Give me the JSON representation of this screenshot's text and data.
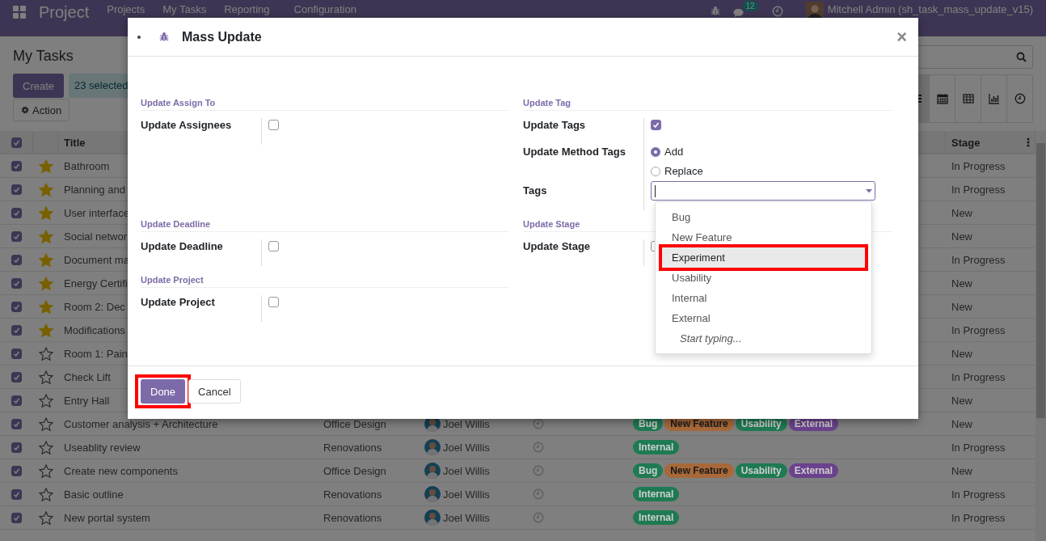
{
  "navbar": {
    "app_name": "Project",
    "menu": [
      "Projects",
      "My Tasks",
      "Reporting",
      "Configuration"
    ],
    "chat_badge": "12",
    "user": "Mitchell Admin (sh_task_mass_update_v15)"
  },
  "control_panel": {
    "title": "My Tasks",
    "create_button": "Create",
    "selection": "23 selected",
    "action_button": "Action",
    "views": [
      {
        "kind": "list",
        "selected": true
      },
      {
        "kind": "calendar",
        "selected": false
      },
      {
        "kind": "pivot",
        "selected": false
      },
      {
        "kind": "graph",
        "selected": false
      },
      {
        "kind": "activity",
        "selected": false
      }
    ]
  },
  "table": {
    "all_checked": true,
    "columns": [
      "Title",
      "Stage"
    ],
    "rows": [
      {
        "checked": true,
        "starred": true,
        "title": "Bathroom",
        "stage": "In Progress"
      },
      {
        "checked": true,
        "starred": true,
        "title": "Planning and",
        "stage": "In Progress"
      },
      {
        "checked": true,
        "starred": true,
        "title": "User interface",
        "stage": "New"
      },
      {
        "checked": true,
        "starred": true,
        "title": "Social networ",
        "stage": "New"
      },
      {
        "checked": true,
        "starred": true,
        "title": "Document ma",
        "stage": "In Progress"
      },
      {
        "checked": true,
        "starred": true,
        "title": "Energy Certifi",
        "stage": "New"
      },
      {
        "checked": true,
        "starred": true,
        "title": "Room 2: Dec",
        "stage": "New"
      },
      {
        "checked": true,
        "starred": true,
        "title": "Modifications",
        "stage": "In Progress"
      },
      {
        "checked": true,
        "starred": false,
        "title": "Room 1: Pain",
        "stage": "New"
      },
      {
        "checked": true,
        "starred": false,
        "title": "Check Lift",
        "stage": "In Progress"
      },
      {
        "checked": true,
        "starred": false,
        "title": "Entry Hall",
        "stage": "New"
      },
      {
        "checked": true,
        "starred": false,
        "title": "Customer analysis + Architecture",
        "project": "Office Design",
        "assignee": "Joel Willis",
        "tags": [
          {
            "label": "Bug",
            "color": "#1e7a52"
          },
          {
            "label": "New Feature",
            "color": "#a8693a"
          },
          {
            "label": "Usability",
            "color": "#1e7a52"
          },
          {
            "label": "External",
            "color": "#6a428c"
          }
        ],
        "stage": "New"
      },
      {
        "checked": true,
        "starred": false,
        "title": "Useablity review",
        "project": "Renovations",
        "assignee": "Joel Willis",
        "tags": [
          {
            "label": "Internal",
            "color": "#1e7a52"
          }
        ],
        "stage": "In Progress"
      },
      {
        "checked": true,
        "starred": false,
        "title": "Create new components",
        "project": "Office Design",
        "assignee": "Joel Willis",
        "tags": [
          {
            "label": "Bug",
            "color": "#1e7a52"
          },
          {
            "label": "New Feature",
            "color": "#a8693a"
          },
          {
            "label": "Usability",
            "color": "#1e7a52"
          },
          {
            "label": "External",
            "color": "#6a428c"
          }
        ],
        "stage": "New"
      },
      {
        "checked": true,
        "starred": false,
        "title": "Basic outline",
        "project": "Renovations",
        "assignee": "Joel Willis",
        "tags": [
          {
            "label": "Internal",
            "color": "#1e7a52"
          }
        ],
        "stage": "In Progress"
      },
      {
        "checked": true,
        "starred": false,
        "title": "New portal system",
        "project": "Renovations",
        "assignee": "Joel Willis",
        "tags": [
          {
            "label": "Internal",
            "color": "#1e7a52"
          }
        ],
        "stage": "In Progress"
      }
    ]
  },
  "dialog": {
    "title": "Mass Update",
    "close": "×",
    "columns": [
      [
        {
          "heading": "Update Assign To",
          "fields": [
            {
              "kind": "checkbox",
              "label": "Update Assignees",
              "checked": false
            }
          ]
        },
        {
          "heading": "Update Deadline",
          "fields": [
            {
              "kind": "checkbox",
              "label": "Update Deadline",
              "checked": false
            }
          ]
        },
        {
          "heading": "Update Project",
          "fields": [
            {
              "kind": "checkbox",
              "label": "Update Project",
              "checked": false
            }
          ]
        }
      ],
      [
        {
          "heading": "Update Tag",
          "fields": [
            {
              "kind": "checkbox",
              "label": "Update Tags",
              "checked": true
            },
            {
              "kind": "radio",
              "label": "Update Method Tags",
              "options": [
                {
                  "label": "Add",
                  "selected": true
                },
                {
                  "label": "Replace",
                  "selected": false
                }
              ]
            },
            {
              "kind": "tags",
              "label": "Tags",
              "dropdown": {
                "options": [
                  {
                    "label": "Bug",
                    "active": false,
                    "annotated": false
                  },
                  {
                    "label": "New Feature",
                    "active": false,
                    "annotated": false
                  },
                  {
                    "label": "Experiment",
                    "active": true,
                    "annotated": true
                  },
                  {
                    "label": "Usability",
                    "active": false,
                    "annotated": false
                  },
                  {
                    "label": "Internal",
                    "active": false,
                    "annotated": false
                  },
                  {
                    "label": "External",
                    "active": false,
                    "annotated": false
                  }
                ],
                "hint": "Start typing..."
              }
            }
          ]
        },
        {
          "heading": "Update Stage",
          "fields": [
            {
              "kind": "checkbox",
              "label": "Update Stage",
              "checked": false
            }
          ]
        }
      ]
    ],
    "buttons": [
      {
        "label": "Done",
        "kind": "primary",
        "annotated": true
      },
      {
        "label": "Cancel",
        "kind": "secondary",
        "annotated": false
      }
    ]
  }
}
